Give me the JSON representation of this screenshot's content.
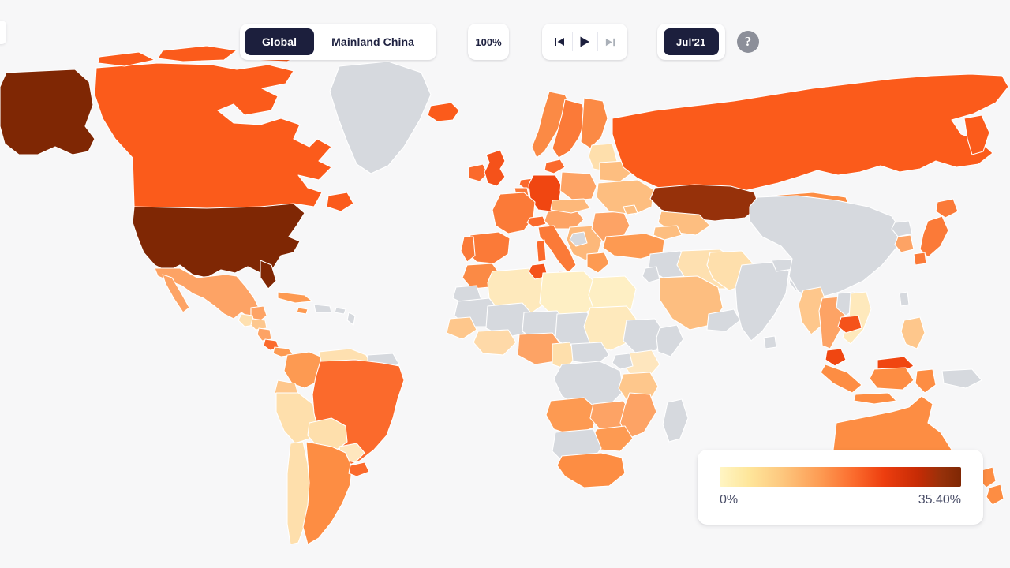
{
  "toolbar": {
    "scope_toggle": {
      "name": "scope-toggle",
      "options": [
        "Global",
        "Mainland China"
      ],
      "selected": "Global"
    },
    "zoom_level": "100%",
    "transport": {
      "skip_back_label": "skip-to-start",
      "play_label": "play",
      "skip_forward_label": "skip-to-end",
      "skip_forward_disabled": true
    },
    "date_label": "Jul'21",
    "help_label": "?"
  },
  "legend": {
    "min_label": "0%",
    "max_label": "35.40%",
    "gradient_stops": [
      "#FFF5C4",
      "#FEE69B",
      "#FDC77E",
      "#FD9A52",
      "#FB6A2C",
      "#ED3E0F",
      "#C72B05",
      "#96310A",
      "#7F2704"
    ]
  },
  "colors": {
    "background": "#f7f7f8",
    "no_data": "#d6d9de",
    "ocean": "#f7f7f8",
    "brand_navy": "#1c1f3d",
    "help_grey": "#8c8f99",
    "legend_text": "#4a4e68",
    "scale_max": "#7F2704",
    "scale_high": "#C72B05",
    "scale_mid": "#FB5B1B",
    "scale_low": "#FDB180",
    "scale_min": "#FFF0B8"
  },
  "chart_data": {
    "type": "heatmap",
    "title": "",
    "subtitle": "",
    "projection": "equirectangular-world",
    "metric": "Share of population (percent)",
    "period": "Jul'21",
    "scope": "Global",
    "value_range": [
      0,
      35.4
    ],
    "unit": "%",
    "legend_position": "bottom-right",
    "no_data_color": "#d6d9de",
    "regions": [
      {
        "name": "United States",
        "value": 33.8,
        "color": "#7F2704"
      },
      {
        "name": "Alaska",
        "value": 33.0,
        "color": "#7F2704"
      },
      {
        "name": "Canada",
        "value": 24.0,
        "color": "#FB5B1B"
      },
      {
        "name": "Greenland",
        "value": null,
        "color": "#d6d9de"
      },
      {
        "name": "Mexico",
        "value": 12.0,
        "color": "#FDA365"
      },
      {
        "name": "Guatemala",
        "value": 5.0,
        "color": "#FED9A8"
      },
      {
        "name": "Cuba",
        "value": 14.0,
        "color": "#FD9A52"
      },
      {
        "name": "Brazil",
        "value": 22.0,
        "color": "#FB6A2C"
      },
      {
        "name": "Argentina",
        "value": 16.0,
        "color": "#FD8D43"
      },
      {
        "name": "Chile",
        "value": 14.0,
        "color": "#FDA365"
      },
      {
        "name": "Peru",
        "value": 9.0,
        "color": "#FED9A8"
      },
      {
        "name": "Colombia",
        "value": 13.0,
        "color": "#FD9A52"
      },
      {
        "name": "Venezuela",
        "value": 6.0,
        "color": "#FEE0B0"
      },
      {
        "name": "Bolivia",
        "value": 9.0,
        "color": "#FEDFAC"
      },
      {
        "name": "Paraguay",
        "value": 6.0,
        "color": "#FEE6BE"
      },
      {
        "name": "Uruguay",
        "value": 20.0,
        "color": "#FB6A2C"
      },
      {
        "name": "Ecuador",
        "value": 10.0,
        "color": "#FEC78C"
      },
      {
        "name": "United Kingdom",
        "value": 28.0,
        "color": "#F5521A"
      },
      {
        "name": "Ireland",
        "value": 24.0,
        "color": "#FB6A2C"
      },
      {
        "name": "France",
        "value": 22.0,
        "color": "#FB7A38"
      },
      {
        "name": "Spain",
        "value": 23.0,
        "color": "#FB7A38"
      },
      {
        "name": "Portugal",
        "value": 22.0,
        "color": "#FB7A38"
      },
      {
        "name": "Germany",
        "value": 29.0,
        "color": "#F04611"
      },
      {
        "name": "Italy",
        "value": 22.0,
        "color": "#FB7A38"
      },
      {
        "name": "Poland",
        "value": 17.0,
        "color": "#FDA365"
      },
      {
        "name": "Norway",
        "value": 20.0,
        "color": "#FB8A45"
      },
      {
        "name": "Sweden",
        "value": 21.0,
        "color": "#FB7A38"
      },
      {
        "name": "Finland",
        "value": 20.0,
        "color": "#FB8A45"
      },
      {
        "name": "Denmark",
        "value": 24.0,
        "color": "#FB6A2C"
      },
      {
        "name": "Iceland",
        "value": 25.0,
        "color": "#FB5B1B"
      },
      {
        "name": "Russia",
        "value": 25.0,
        "color": "#FB5B1B"
      },
      {
        "name": "Ukraine",
        "value": 10.0,
        "color": "#FDBE80"
      },
      {
        "name": "Belarus",
        "value": 12.0,
        "color": "#FDBE80"
      },
      {
        "name": "Kazakhstan",
        "value": 31.0,
        "color": "#96310A"
      },
      {
        "name": "Turkey",
        "value": 18.0,
        "color": "#FD9A52"
      },
      {
        "name": "Iran",
        "value": 8.0,
        "color": "#FEE0B0"
      },
      {
        "name": "Saudi Arabia",
        "value": 12.0,
        "color": "#FDBE80"
      },
      {
        "name": "Egypt",
        "value": 4.0,
        "color": "#FEEFC4"
      },
      {
        "name": "Morocco",
        "value": 20.0,
        "color": "#FB8A45"
      },
      {
        "name": "Algeria",
        "value": 4.0,
        "color": "#FEE9BC"
      },
      {
        "name": "Libya",
        "value": 5.0,
        "color": "#FEEFC4"
      },
      {
        "name": "Tunisia",
        "value": 22.0,
        "color": "#F5521A"
      },
      {
        "name": "Sudan",
        "value": 3.0,
        "color": "#FEE9BC"
      },
      {
        "name": "Nigeria",
        "value": 9.0,
        "color": "#FDA365"
      },
      {
        "name": "Ethiopia",
        "value": null,
        "color": "#d6d9de"
      },
      {
        "name": "Kenya",
        "value": 4.0,
        "color": "#FEE6BE"
      },
      {
        "name": "Tanzania",
        "value": 6.0,
        "color": "#FEC78C"
      },
      {
        "name": "Angola",
        "value": 11.0,
        "color": "#FD9A52"
      },
      {
        "name": "Zambia",
        "value": 9.0,
        "color": "#FDA365"
      },
      {
        "name": "Zimbabwe",
        "value": 11.0,
        "color": "#FD9A52"
      },
      {
        "name": "South Africa",
        "value": 12.0,
        "color": "#FD8D43"
      },
      {
        "name": "Democratic Republic of the Congo",
        "value": null,
        "color": "#d6d9de"
      },
      {
        "name": "Chad",
        "value": null,
        "color": "#d6d9de"
      },
      {
        "name": "Niger",
        "value": null,
        "color": "#d6d9de"
      },
      {
        "name": "Mali",
        "value": null,
        "color": "#d6d9de"
      },
      {
        "name": "Madagascar",
        "value": null,
        "color": "#d6d9de"
      },
      {
        "name": "Mainland China",
        "value": null,
        "color": "#d6d9de"
      },
      {
        "name": "Mongolia",
        "value": 20.0,
        "color": "#FD8D43"
      },
      {
        "name": "Japan",
        "value": 22.0,
        "color": "#FB7A38"
      },
      {
        "name": "South Korea",
        "value": 15.0,
        "color": "#FDA365"
      },
      {
        "name": "India",
        "value": null,
        "color": "#d6d9de"
      },
      {
        "name": "Pakistan",
        "value": 5.0,
        "color": "#FEDFAC"
      },
      {
        "name": "Thailand",
        "value": 10.0,
        "color": "#FDA365"
      },
      {
        "name": "Vietnam",
        "value": 3.0,
        "color": "#FEE9BC"
      },
      {
        "name": "Cambodia",
        "value": 25.0,
        "color": "#F5521A"
      },
      {
        "name": "Myanmar",
        "value": 6.0,
        "color": "#FEC78C"
      },
      {
        "name": "Malaysia",
        "value": 26.0,
        "color": "#F04611"
      },
      {
        "name": "Indonesia",
        "value": 12.0,
        "color": "#FD8D43"
      },
      {
        "name": "Philippines",
        "value": 7.0,
        "color": "#FEC78C"
      },
      {
        "name": "Australia",
        "value": 14.0,
        "color": "#FD8D43"
      },
      {
        "name": "New Zealand",
        "value": 14.0,
        "color": "#FD8D43"
      },
      {
        "name": "Papua New Guinea",
        "value": null,
        "color": "#d6d9de"
      }
    ]
  }
}
